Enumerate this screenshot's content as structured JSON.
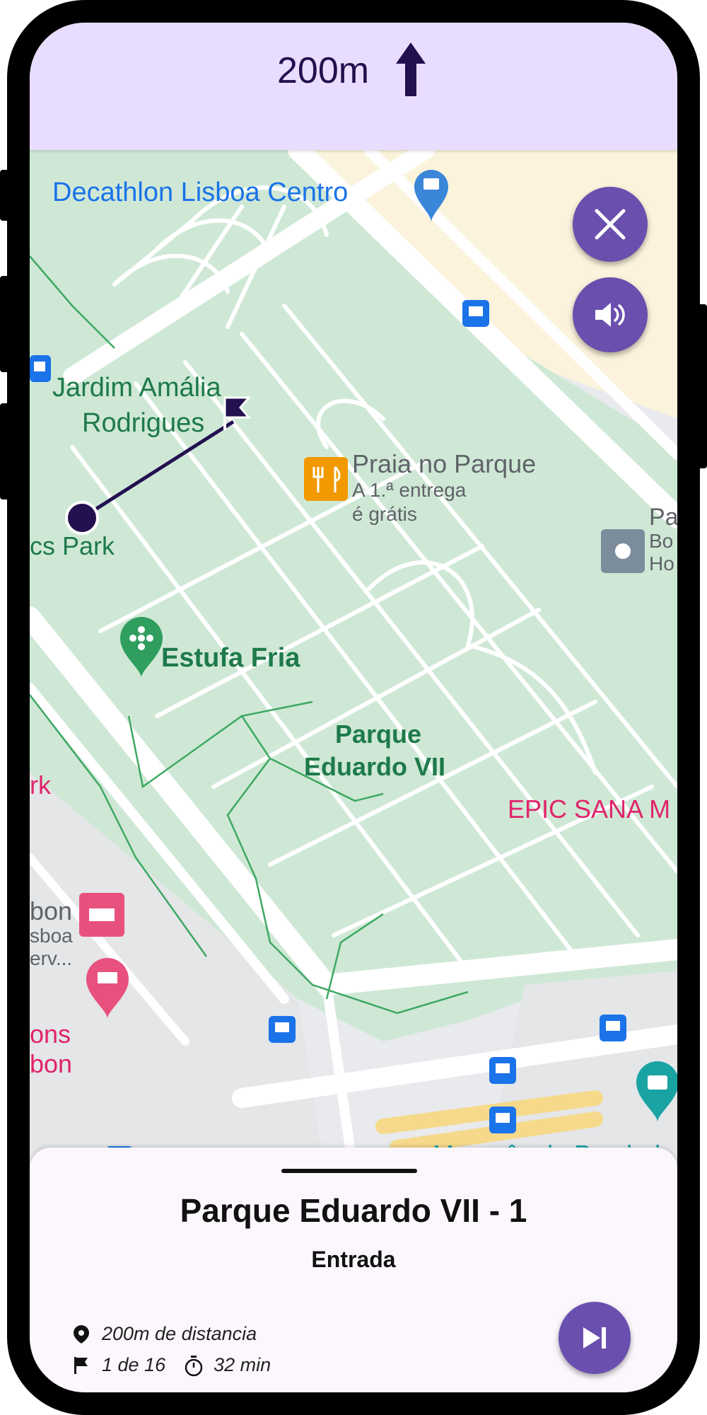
{
  "nav": {
    "distance": "200m",
    "direction_icon": "arrow-up-icon"
  },
  "map": {
    "labels": {
      "decathlon": "Decathlon Lisboa Centro",
      "jardim_1": "Jardim Amália",
      "jardim_2": "Rodrigues",
      "praia_title": "Praia no Parque",
      "praia_line1": "A 1.ª entrega",
      "praia_line2": "é grátis",
      "park_fragment": "cs Park",
      "estufa": "Estufa Fria",
      "parque_1": "Parque",
      "parque_2": "Eduardo VII",
      "epic": "EPIC SANA M",
      "rk": "rk",
      "pa": "Pa",
      "bo": "Bo",
      "ho": "Ho",
      "bon_1": "bon",
      "bon_2": "sboa",
      "bon_3": "erv...",
      "ons_1": "ons",
      "ons_2": "bon",
      "marques": "Marquês de Pombal"
    }
  },
  "controls": {
    "close_icon": "close-icon",
    "sound_icon": "volume-icon"
  },
  "sheet": {
    "title": "Parque Eduardo VII - 1",
    "subtitle": "Entrada",
    "distance_info": "200m de distancia",
    "progress": "1 de 16",
    "time": "32 min"
  },
  "colors": {
    "accent": "#6a4fae",
    "topbar": "#e9ddff",
    "route": "#23104f",
    "park_green": "#cfe8d6",
    "map_label_green": "#1e7a4a",
    "map_label_blue": "#1a73e8",
    "map_label_pink": "#e0246a"
  }
}
